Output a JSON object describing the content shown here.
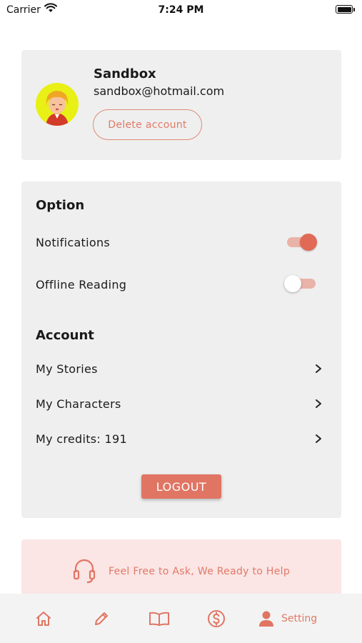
{
  "status_bar": {
    "carrier": "Carrier",
    "time": "7:24 PM"
  },
  "profile": {
    "name": "Sandbox",
    "email": "sandbox@hotmail.com",
    "delete_label": "Delete account"
  },
  "options": {
    "title": "Option",
    "notifications": {
      "label": "Notifications",
      "enabled": true
    },
    "offline_reading": {
      "label": "Offline Reading",
      "enabled": false
    }
  },
  "account": {
    "title": "Account",
    "items": [
      {
        "label": "My Stories"
      },
      {
        "label": "My Characters"
      },
      {
        "label": "My credits: 191"
      }
    ]
  },
  "logout_label": "LOGOUT",
  "help": {
    "text": "Feel Free to Ask, We Ready to Help",
    "icon": "headset-icon"
  },
  "tabbar": {
    "items": [
      {
        "icon": "home-icon"
      },
      {
        "icon": "pencil-icon"
      },
      {
        "icon": "book-icon"
      },
      {
        "icon": "dollar-icon"
      },
      {
        "icon": "user-icon",
        "label": "Setting",
        "active": true
      }
    ]
  },
  "colors": {
    "accent": "#e07563",
    "card": "#efefef",
    "help_bg": "#fbe5e5",
    "avatar_bg": "#e8f016"
  }
}
